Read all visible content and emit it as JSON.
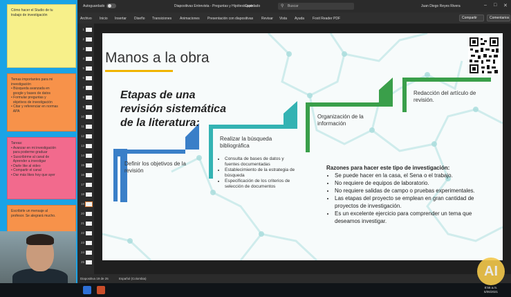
{
  "notes": [
    {
      "text": "Cómo hacer el Studio de tu\ntrabajo de investigación"
    },
    {
      "text": "Temas importantes para mi\ninvestigación\n• Búsqueda avanzada en\n  google y bases de datos\n• Formular preguntas y\n  objetivos de investigación\n• Citar y referenciar en normas\n  APA"
    },
    {
      "text": "Tareas:\n• Avanzar en mi investigación\n  para poderme graduar\n• Suscribirme al canal de\n  Aprender a investigar\n• Darle like al video\n• Compartir el canal\n• Dar más likes hoy que ayer"
    },
    {
      "text": "Escribirle un mensaje al\nprofesor. Se alegrará mucho."
    }
  ],
  "titlebar": {
    "autosave": "Autoguardado",
    "document": "Diapositivas Entrevista - Preguntas y Hipótesis.pptx",
    "saved": "Guardado",
    "search_placeholder": "Buscar",
    "user": "Juan Diego Reyes Rivera"
  },
  "ribbon": {
    "tabs": [
      "Archivo",
      "Inicio",
      "Insertar",
      "Diseño",
      "Transiciones",
      "Animaciones",
      "Presentación con diapositivas",
      "Revisar",
      "Vista",
      "Ayuda",
      "Foxit Reader PDF"
    ],
    "share": "Compartir",
    "comments": "Comentarios"
  },
  "thumbnails": {
    "numbers": [
      "1",
      "2",
      "3",
      "4",
      "5",
      "6",
      "7",
      "8",
      "9",
      "10",
      "11",
      "12",
      "13",
      "14",
      "15",
      "16",
      "17",
      "18",
      "19",
      "20",
      "21",
      "22",
      "23",
      "24",
      "25"
    ],
    "active": "19"
  },
  "slide": {
    "title": "Manos a la obra",
    "heading": "Etapas de una revisión sistemática de la literatura:",
    "step1": "Definir los objetivos de la revisión",
    "step2": "Realizar la búsqueda bibliográfica",
    "step2_bullets": [
      "Consulta de bases de datos y fuentes documentadas",
      "Establecimiento de la estrategia de búsqueda",
      "Especificación de los criterios de selección de documentos"
    ],
    "step3": "Organización de la información",
    "step4": "Redacción del artículo de revisión.",
    "reasons_title": "Razones para hacer este tipo de investigación:",
    "reasons": [
      "Se puede hacer en la casa, el Sena o el trabajo.",
      "No requiere de equipos de laboratorio.",
      "No requiere salidas de campo o pruebas experimentales.",
      "Las etapas del proyecto se emplean en gran cantidad de proyectos de investigación.",
      "Es un excelente ejercicio para comprender un tema que deseamos investigar."
    ]
  },
  "statusbar": {
    "slide_info": "Diapositiva 19 de 25",
    "language": "Español (Colombia)"
  },
  "taskbar": {
    "time": "8:56 a.m.",
    "date": "5/06/2021"
  },
  "colors": {
    "step_blue": "#3a7fc8",
    "step_teal": "#34b3b3",
    "step_green": "#3a9f4a",
    "title_underline": "#f0b400"
  },
  "ai_logo": "AI"
}
